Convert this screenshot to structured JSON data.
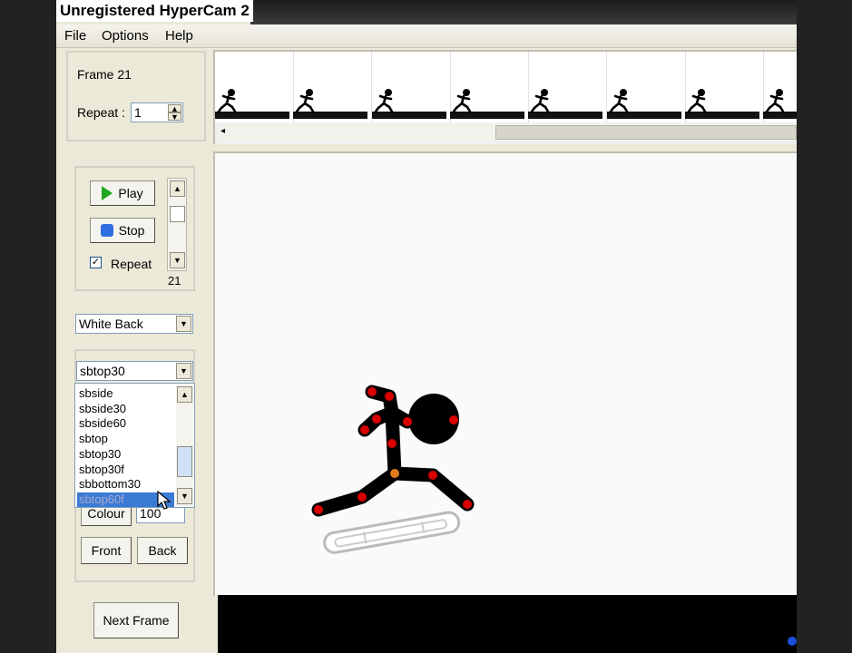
{
  "watermark": "Unregistered HyperCam 2",
  "menu": [
    "File",
    "Options",
    "Help"
  ],
  "frame_info": {
    "frame_label": "Frame 21",
    "repeat_label": "Repeat :",
    "repeat_value": "1"
  },
  "playback": {
    "play_label": "Play",
    "stop_label": "Stop",
    "repeat_checkbox_label": "Repeat",
    "repeat_checked": true,
    "scroll_value": "21"
  },
  "background_select": {
    "value": "White Back"
  },
  "figure_select": {
    "value": "sbtop30",
    "options": [
      "sbside",
      "sbside30",
      "sbside60",
      "sbtop",
      "sbtop30",
      "sbtop30f",
      "sbbottom30",
      "sbtop60f"
    ],
    "selected_index": 7
  },
  "colour": {
    "button_label": "Colour",
    "value": "100"
  },
  "order": {
    "front_label": "Front",
    "back_label": "Back"
  },
  "next_frame_label": "Next Frame",
  "timeline": {
    "frame_count_visible": 8
  },
  "colors": {
    "joint": "#d80000",
    "origin_joint": "#e07a1a",
    "figure": "#000000",
    "accent": "#3a7bd5"
  }
}
